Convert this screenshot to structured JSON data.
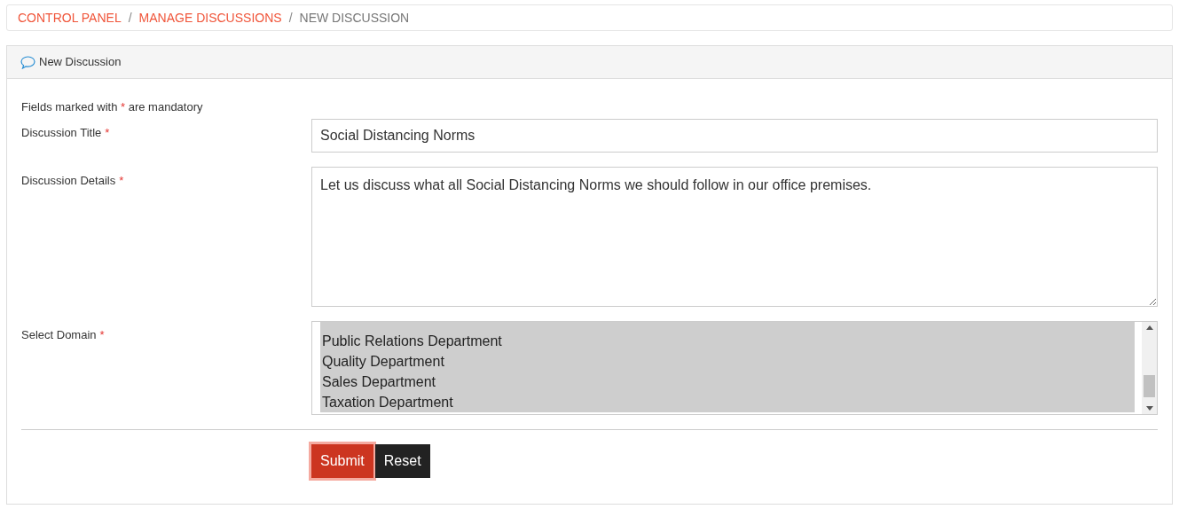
{
  "breadcrumb": [
    {
      "label": "CONTROL PANEL",
      "link": true
    },
    {
      "label": "MANAGE DISCUSSIONS",
      "link": true
    },
    {
      "label": "NEW DISCUSSION",
      "link": false
    }
  ],
  "separator": "/",
  "panel": {
    "title": "New Discussion"
  },
  "note": {
    "before": "Fields marked with",
    "star": "*",
    "after": "are mandatory"
  },
  "fields": [
    {
      "kind": "text",
      "label": "Discussion Title",
      "required": true,
      "value": "Social Distancing Norms"
    },
    {
      "kind": "textarea",
      "label": "Discussion Details",
      "required": true,
      "value": "Let us discuss what all Social Distancing Norms we should follow in our office premises."
    },
    {
      "kind": "listbox",
      "label": "Select Domain",
      "required": true,
      "options": [
        {
          "label": "Public Relations Department",
          "selected": true
        },
        {
          "label": "Quality Department",
          "selected": true
        },
        {
          "label": "Sales Department",
          "selected": true
        },
        {
          "label": "Taxation Department",
          "selected": true
        }
      ]
    }
  ],
  "buttons": [
    {
      "kind": "primary",
      "label": "Submit",
      "focused": true
    },
    {
      "kind": "secondary",
      "label": "Reset",
      "focused": false
    }
  ]
}
